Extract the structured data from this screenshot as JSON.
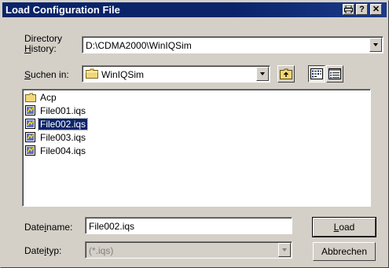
{
  "window": {
    "title": "Load Configuration File",
    "buttons": {
      "print": "⎙",
      "help": "?",
      "close": "✕"
    }
  },
  "directory_history": {
    "label_line1": "Directory",
    "label_line2_pre": "",
    "label_line2_u": "H",
    "label_line2_post": "istory:",
    "value": "D:\\CDMA2000\\WinIQSim"
  },
  "look_in": {
    "label_u": "S",
    "label_post": "uchen in:",
    "value": "WinIQSim"
  },
  "files": [
    {
      "name": "Acp",
      "type": "folder",
      "selected": false
    },
    {
      "name": "File001.iqs",
      "type": "file",
      "selected": false
    },
    {
      "name": "File002.iqs",
      "type": "file",
      "selected": true
    },
    {
      "name": "File003.iqs",
      "type": "file",
      "selected": false
    },
    {
      "name": "File004.iqs",
      "type": "file",
      "selected": false
    }
  ],
  "filename": {
    "label_pre": "Date",
    "label_u": "i",
    "label_post": "name:",
    "value": "File002.iqs"
  },
  "filetype": {
    "label_pre": "Date",
    "label_u": "i",
    "label_post": "typ:",
    "value": "(*.iqs)"
  },
  "actions": {
    "load_u": "L",
    "load_post": "oad",
    "cancel": "Abbrechen"
  },
  "colors": {
    "title_bar": "#0a246a",
    "selection": "#0a246a",
    "face": "#d4d0c8"
  },
  "icons": {
    "folder": "folder-icon",
    "file": "iqs-file-icon",
    "up": "up-one-level-icon",
    "list_view": "list-view-icon",
    "details_view": "details-view-icon"
  }
}
